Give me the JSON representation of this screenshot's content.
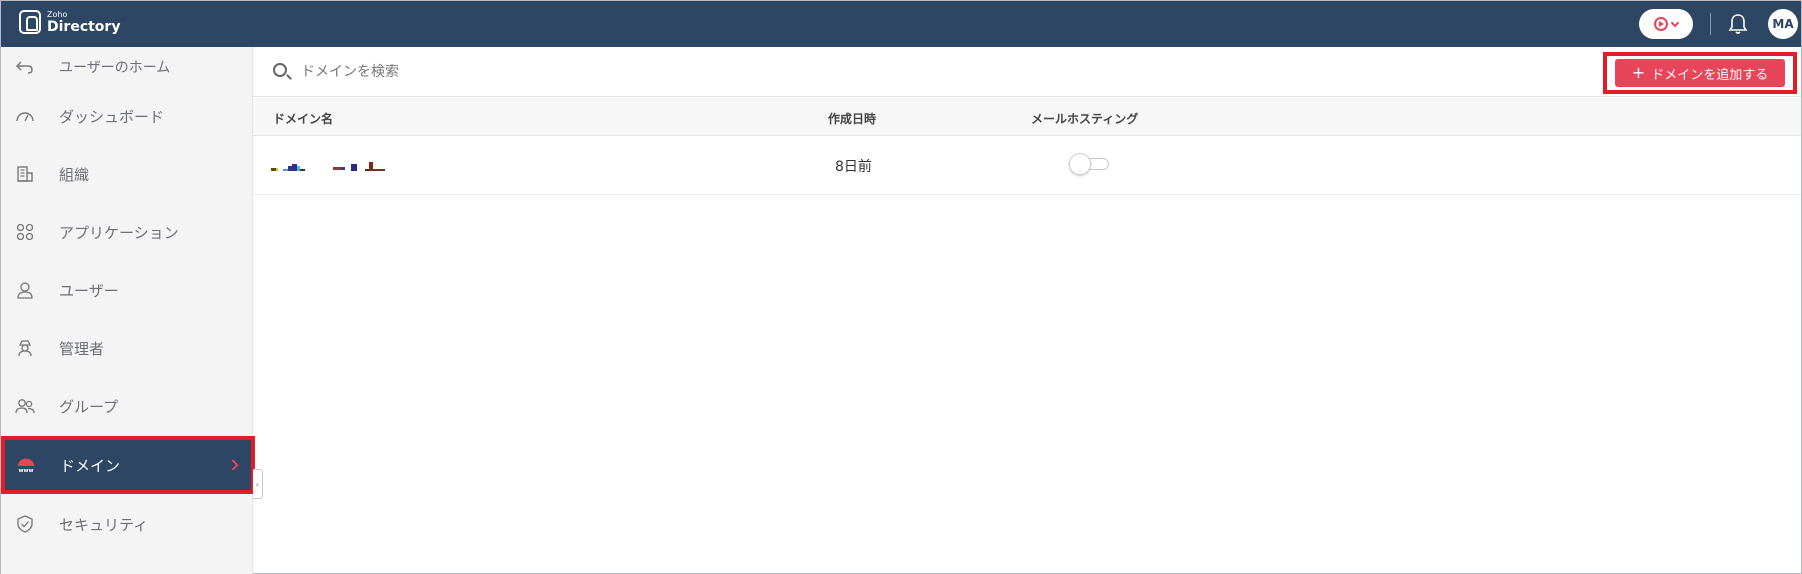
{
  "header": {
    "brand_small": "Zoho",
    "brand_name": "Directory",
    "avatar_initials": "MA",
    "icons": [
      "record-icon",
      "bell-icon"
    ]
  },
  "sidebar": {
    "home_label": "ユーザーのホーム",
    "items": [
      {
        "label": "ダッシュボード",
        "icon": "dashboard-icon"
      },
      {
        "label": "組織",
        "icon": "building-icon"
      },
      {
        "label": "アプリケーション",
        "icon": "apps-icon"
      },
      {
        "label": "ユーザー",
        "icon": "user-icon"
      },
      {
        "label": "管理者",
        "icon": "admin-icon"
      },
      {
        "label": "グループ",
        "icon": "group-icon"
      },
      {
        "label": "ドメイン",
        "icon": "www-icon",
        "active": true
      },
      {
        "label": "セキュリティ",
        "icon": "shield-icon"
      }
    ]
  },
  "main": {
    "search_placeholder": "ドメインを検索",
    "add_button_label": "ドメインを追加する",
    "columns": [
      "ドメイン名",
      "作成日時",
      "メールホスティング"
    ],
    "rows": [
      {
        "domain": "(redacted)",
        "created": "8日前",
        "mail_hosting": false
      }
    ]
  },
  "colors": {
    "topbar": "#2c4663",
    "accent": "#e8445a",
    "highlight_border": "#e01e2a"
  }
}
